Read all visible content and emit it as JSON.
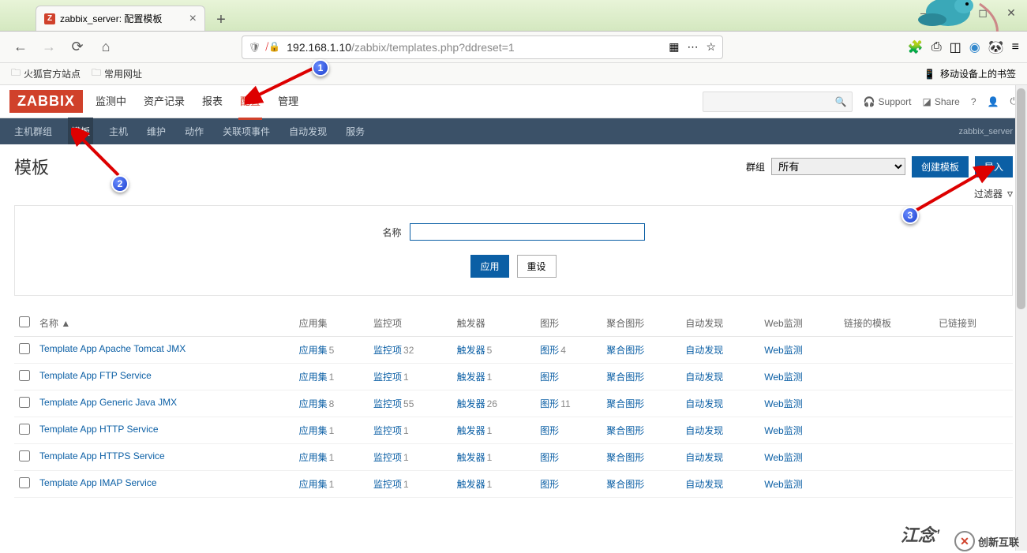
{
  "browser": {
    "tab_favicon": "Z",
    "tab_title": "zabbix_server: 配置模板",
    "url_display_prefix": "192.168.1.10",
    "url_display_path": "/zabbix/templates.php?ddreset=1",
    "bookmarks": [
      "火狐官方站点",
      "常用网址"
    ],
    "bookmarks_right": "移动设备上的书签"
  },
  "zabbix": {
    "logo": "ZABBIX",
    "main_nav": [
      "监测中",
      "资产记录",
      "报表",
      "配置",
      "管理"
    ],
    "main_nav_active": "配置",
    "support": "Support",
    "share": "Share",
    "sub_nav": [
      "主机群组",
      "模板",
      "主机",
      "维护",
      "动作",
      "关联项事件",
      "自动发现",
      "服务"
    ],
    "sub_nav_active": "模板",
    "server_name": "zabbix_server"
  },
  "page": {
    "title": "模板",
    "group_label": "群组",
    "group_selected": "所有",
    "btn_create": "创建模板",
    "btn_import": "导入",
    "filter_toggle": "过滤器",
    "filter_name_label": "名称",
    "filter_name_value": "",
    "btn_apply": "应用",
    "btn_reset": "重设"
  },
  "table": {
    "headers": [
      "名称 ▲",
      "应用集",
      "监控项",
      "触发器",
      "图形",
      "聚合图形",
      "自动发现",
      "Web监测",
      "链接的模板",
      "已链接到"
    ],
    "rows": [
      {
        "name": "Template App Apache Tomcat JMX",
        "app": [
          "应用集",
          "5"
        ],
        "item": [
          "监控项",
          "32"
        ],
        "trig": [
          "触发器",
          "5"
        ],
        "graph": [
          "图形",
          "4"
        ],
        "screen": "聚合图形",
        "disc": "自动发现",
        "web": "Web监测"
      },
      {
        "name": "Template App FTP Service",
        "app": [
          "应用集",
          "1"
        ],
        "item": [
          "监控项",
          "1"
        ],
        "trig": [
          "触发器",
          "1"
        ],
        "graph": [
          "图形",
          ""
        ],
        "screen": "聚合图形",
        "disc": "自动发现",
        "web": "Web监测"
      },
      {
        "name": "Template App Generic Java JMX",
        "app": [
          "应用集",
          "8"
        ],
        "item": [
          "监控项",
          "55"
        ],
        "trig": [
          "触发器",
          "26"
        ],
        "graph": [
          "图形",
          "11"
        ],
        "screen": "聚合图形",
        "disc": "自动发现",
        "web": "Web监测"
      },
      {
        "name": "Template App HTTP Service",
        "app": [
          "应用集",
          "1"
        ],
        "item": [
          "监控项",
          "1"
        ],
        "trig": [
          "触发器",
          "1"
        ],
        "graph": [
          "图形",
          ""
        ],
        "screen": "聚合图形",
        "disc": "自动发现",
        "web": "Web监测"
      },
      {
        "name": "Template App HTTPS Service",
        "app": [
          "应用集",
          "1"
        ],
        "item": [
          "监控项",
          "1"
        ],
        "trig": [
          "触发器",
          "1"
        ],
        "graph": [
          "图形",
          ""
        ],
        "screen": "聚合图形",
        "disc": "自动发现",
        "web": "Web监测"
      },
      {
        "name": "Template App IMAP Service",
        "app": [
          "应用集",
          "1"
        ],
        "item": [
          "监控项",
          "1"
        ],
        "trig": [
          "触发器",
          "1"
        ],
        "graph": [
          "图形",
          ""
        ],
        "screen": "聚合图形",
        "disc": "自动发现",
        "web": "Web监测"
      }
    ]
  },
  "callouts": {
    "c1": "1",
    "c2": "2",
    "c3": "3"
  },
  "watermarks": {
    "w1": "江念'",
    "w2": "创新互联"
  }
}
